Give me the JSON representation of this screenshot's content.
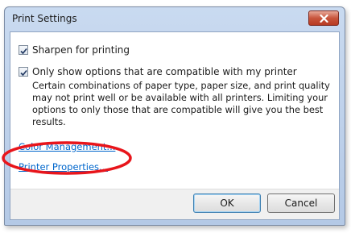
{
  "window": {
    "title": "Print Settings"
  },
  "options": {
    "sharpen": {
      "label": "Sharpen for printing",
      "checked": true
    },
    "compatible": {
      "label": "Only show options that are compatible with my printer",
      "checked": true
    }
  },
  "description": "Certain combinations of paper type, paper size, and print quality may not print well or be available with all printers.  Limiting your options to only those that are compatible will give you the best results.",
  "links": {
    "color_management": "Color Management...",
    "printer_properties": "Printer Properties..."
  },
  "buttons": {
    "ok": "OK",
    "cancel": "Cancel"
  },
  "colors": {
    "link": "#0066cc",
    "annotation": "#e8151b",
    "close_button": "#c8553c"
  }
}
